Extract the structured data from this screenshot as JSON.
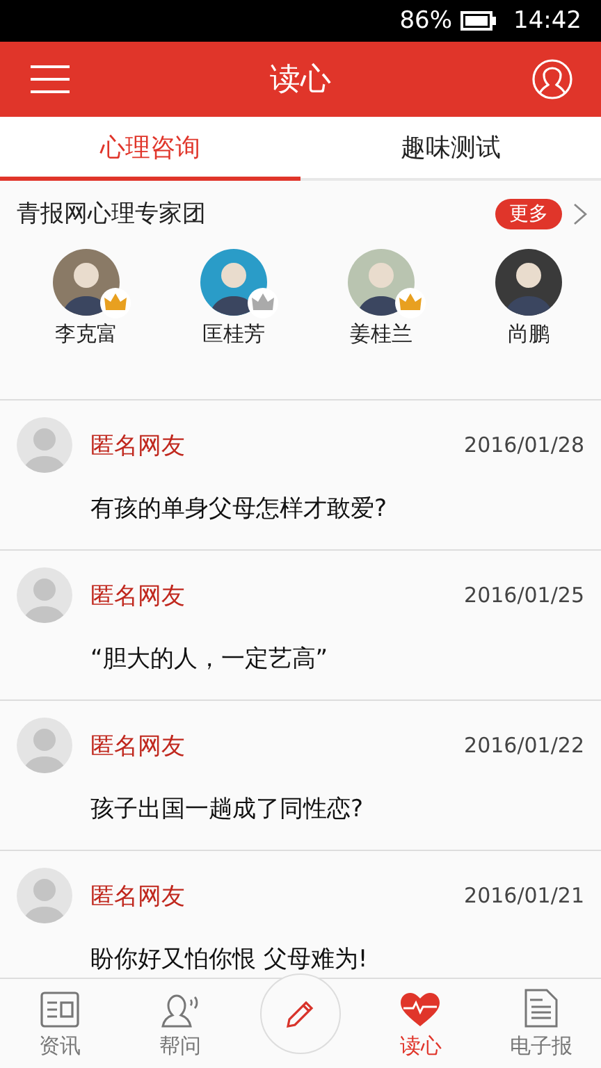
{
  "status_bar": {
    "battery": "86%",
    "time": "14:42"
  },
  "header": {
    "title": "读心"
  },
  "tabs": [
    {
      "label": "心理咨询",
      "selected": true
    },
    {
      "label": "趣味测试",
      "selected": false
    }
  ],
  "experts": {
    "title": "青报网心理专家团",
    "more": "更多",
    "people": [
      {
        "name": "李克富",
        "color": "#e8a020"
      },
      {
        "name": "匡桂芳",
        "color": "#aaaaaa"
      },
      {
        "name": "姜桂兰",
        "color": "#e8a020"
      },
      {
        "name": "尚鹏"
      }
    ]
  },
  "posts": [
    {
      "author": "匿名网友",
      "date": "2016/01/28",
      "text": "有孩的单身父母怎样才敢爱?"
    },
    {
      "author": "匿名网友",
      "date": "2016/01/25",
      "text": "“胆大的人，一定艺高”"
    },
    {
      "author": "匿名网友",
      "date": "2016/01/22",
      "text": "孩子出国一趟成了同性恋?"
    },
    {
      "author": "匿名网友",
      "date": "2016/01/21",
      "text": "盼你好又怕你恨 父母难为!"
    }
  ],
  "nav": [
    {
      "kind": "news",
      "label": "资讯",
      "selected": false
    },
    {
      "kind": "help",
      "label": "帮问",
      "selected": false
    },
    {
      "kind": "compose"
    },
    {
      "kind": "heart",
      "label": "读心",
      "selected": true
    },
    {
      "kind": "paper",
      "label": "电子报",
      "selected": false
    }
  ]
}
